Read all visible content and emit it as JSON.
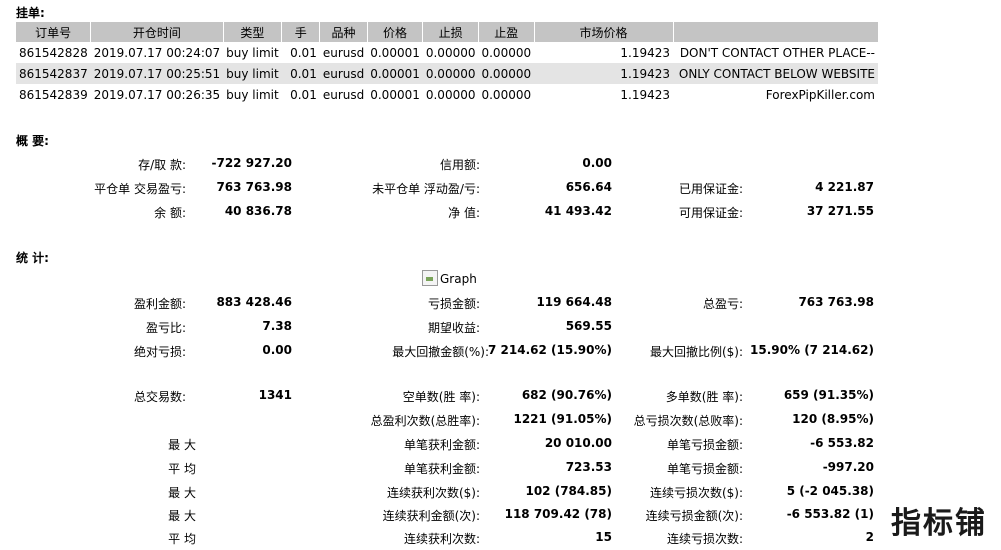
{
  "pending": {
    "title": "挂单:",
    "headers": [
      "订单号",
      "开仓时间",
      "类型",
      "手",
      "品种",
      "价格",
      "止损",
      "止盈",
      "市场价格",
      ""
    ],
    "rows": [
      {
        "ticket": "861542828",
        "time": "2019.07.17 00:24:07",
        "type": "buy limit",
        "lots": "0.01",
        "symbol": "eurusd",
        "price": "0.00001",
        "sl": "0.00000",
        "tp": "0.00000",
        "market": "1.19423",
        "comment": "DON'T CONTACT OTHER PLACE--"
      },
      {
        "ticket": "861542837",
        "time": "2019.07.17 00:25:51",
        "type": "buy limit",
        "lots": "0.01",
        "symbol": "eurusd",
        "price": "0.00001",
        "sl": "0.00000",
        "tp": "0.00000",
        "market": "1.19423",
        "comment": "ONLY CONTACT BELOW WEBSITE"
      },
      {
        "ticket": "861542839",
        "time": "2019.07.17 00:26:35",
        "type": "buy limit",
        "lots": "0.01",
        "symbol": "eurusd",
        "price": "0.00001",
        "sl": "0.00000",
        "tp": "0.00000",
        "market": "1.19423",
        "comment": "ForexPipKiller.com"
      }
    ]
  },
  "summary": {
    "title": "概 要:",
    "deposit_label": "存/取 款:",
    "deposit_value": "-722 927.20",
    "credit_label": "信用额:",
    "credit_value": "0.00",
    "closed_pl_label": "平仓单 交易盈亏:",
    "closed_pl_value": "763 763.98",
    "floating_pl_label": "未平仓单 浮动盈/亏:",
    "floating_pl_value": "656.64",
    "margin_label": "已用保证金:",
    "margin_value": "4 221.87",
    "balance_label": "余 额:",
    "balance_value": "40 836.78",
    "equity_label": "净 值:",
    "equity_value": "41 493.42",
    "free_margin_label": "可用保证金:",
    "free_margin_value": "37 271.55"
  },
  "stats": {
    "title": "统 计:",
    "graph_alt": "Graph",
    "gross_profit_label": "盈利金额:",
    "gross_profit_value": "883 428.46",
    "gross_loss_label": "亏损金额:",
    "gross_loss_value": "119 664.48",
    "total_net_label": "总盈亏:",
    "total_net_value": "763 763.98",
    "profit_factor_label": "盈亏比:",
    "profit_factor_value": "7.38",
    "expected_payoff_label": "期望收益:",
    "expected_payoff_value": "569.55",
    "abs_drawdown_label": "绝对亏损:",
    "abs_drawdown_value": "0.00",
    "max_drawdown_label": "最大回撤金额(%):",
    "max_drawdown_value": "7 214.62 (15.90%)",
    "rel_drawdown_label": "最大回撤比例($):",
    "rel_drawdown_value": "15.90% (7 214.62)",
    "total_trades_label": "总交易数:",
    "total_trades_value": "1341",
    "short_label": "空单数(胜 率):",
    "short_value": "682 (90.76%)",
    "long_label": "多单数(胜 率):",
    "long_value": "659 (91.35%)",
    "profit_trades_label": "总盈利次数(总胜率):",
    "profit_trades_value": "1221 (91.05%)",
    "loss_trades_label": "总亏损次数(总败率):",
    "loss_trades_value": "120 (8.95%)",
    "largest_label": "最 大",
    "largest_profit_label": "单笔获利金额:",
    "largest_profit_value": "20 010.00",
    "largest_loss_label": "单笔亏损金额:",
    "largest_loss_value": "-6 553.82",
    "average_label": "平 均",
    "avg_profit_label": "单笔获利金额:",
    "avg_profit_value": "723.53",
    "avg_loss_label": "单笔亏损金额:",
    "avg_loss_value": "-997.20",
    "max_label": "最 大",
    "max_consec_wins_label": "连续获利次数($):",
    "max_consec_wins_value": "102 (784.85)",
    "max_consec_losses_label": "连续亏损次数($):",
    "max_consec_losses_value": "5 (-2 045.38)",
    "maximal_label": "最 大",
    "maximal_consec_profit_label": "连续获利金额(次):",
    "maximal_consec_profit_value": "118 709.42 (78)",
    "maximal_consec_loss_label": "连续亏损金额(次):",
    "maximal_consec_loss_value": "-6 553.82 (1)",
    "avg_consec_label": "平 均",
    "avg_consec_wins_label": "连续获利次数:",
    "avg_consec_wins_value": "15",
    "avg_consec_losses_label": "连续亏损次数:",
    "avg_consec_losses_value": "2"
  },
  "watermark": "指标铺"
}
